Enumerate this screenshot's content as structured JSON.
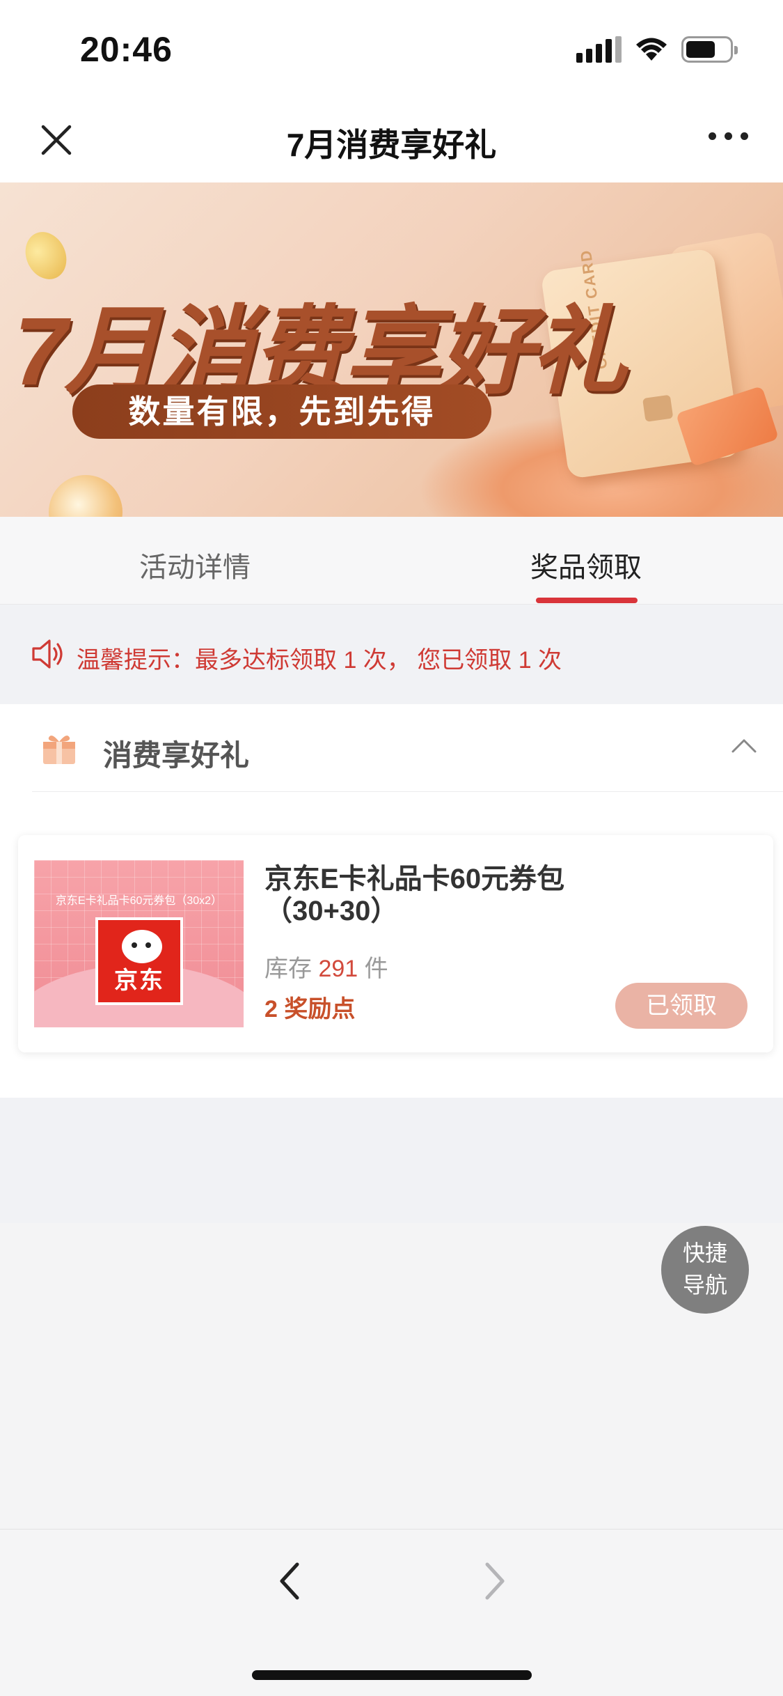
{
  "status_bar": {
    "time": "20:46"
  },
  "nav": {
    "title": "7月消费享好礼"
  },
  "banner": {
    "title": "7月消费享好礼",
    "subtitle": "数量有限，先到先得",
    "card_text": "CREDIT CARD"
  },
  "tabs": [
    {
      "label": "活动详情",
      "active": false
    },
    {
      "label": "奖品领取",
      "active": true
    }
  ],
  "notice": {
    "text": "温馨提示：最多达标领取 1 次， 您已领取 1 次"
  },
  "section": {
    "title": "消费享好礼",
    "expanded": true
  },
  "reward": {
    "thumb_caption": "京东E卡礼品卡60元券包（30x2）",
    "thumb_logo_text": "京东",
    "title": "京东E卡礼品卡60元券包（30+30）",
    "stock_prefix": "库存",
    "stock_count": "291",
    "stock_suffix": "件",
    "points": "2 奖励点",
    "status_button": "已领取"
  },
  "quick_nav": {
    "line1": "快捷",
    "line2": "导航"
  },
  "colors": {
    "accent_red": "#d9343a",
    "notice_red": "#cf3a34",
    "claimed_button": "#eab3a5",
    "points_orange": "#c8502a"
  },
  "icons": [
    "close-icon",
    "more-icon",
    "speaker-icon",
    "gift-icon",
    "chevron-up-icon",
    "back-arrow-icon",
    "forward-arrow-icon"
  ]
}
